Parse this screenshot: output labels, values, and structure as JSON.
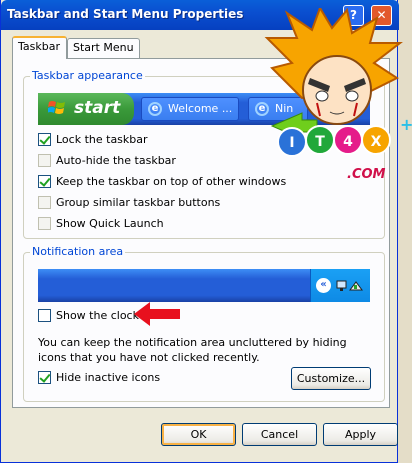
{
  "window": {
    "title": "Taskbar and Start Menu Properties",
    "help_label": "?",
    "close_label": "✕"
  },
  "tabs": [
    {
      "label": "Taskbar",
      "active": true
    },
    {
      "label": "Start Menu",
      "active": false
    }
  ],
  "taskbar_appearance": {
    "legend": "Taskbar appearance",
    "preview": {
      "start_label": "start",
      "buttons": [
        "Welcome ...",
        "Nin"
      ]
    },
    "options": [
      {
        "label": "Lock the taskbar",
        "checked": true
      },
      {
        "label": "Auto-hide the taskbar",
        "checked": false
      },
      {
        "label": "Keep the taskbar on top of other windows",
        "checked": true
      },
      {
        "label": "Group similar taskbar buttons",
        "checked": false
      },
      {
        "label": "Show Quick Launch",
        "checked": false
      }
    ]
  },
  "notification_area": {
    "legend": "Notification area",
    "tray_chevron": "«",
    "show_clock": {
      "label": "Show the clock",
      "checked": false
    },
    "description": "You can keep the notification area uncluttered by hiding icons that you have not clicked recently.",
    "hide_inactive": {
      "label": "Hide inactive icons",
      "checked": true
    },
    "customize_label": "Customize..."
  },
  "footer": {
    "ok_label": "OK",
    "cancel_label": "Cancel",
    "apply_label": "Apply"
  },
  "watermark": {
    "text": "IT4X",
    "domain": ".COM"
  },
  "colors": {
    "title_bar": "#0a4fd0",
    "accent_arrow": "#e8101e",
    "legend_text": "#0046d5"
  }
}
